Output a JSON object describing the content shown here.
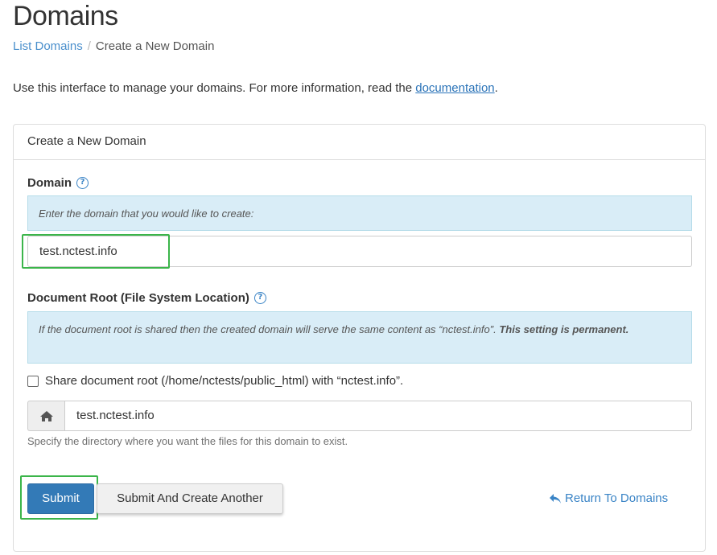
{
  "page": {
    "title": "Domains"
  },
  "breadcrumb": {
    "link": "List Domains",
    "separator": "/",
    "current": "Create a New Domain"
  },
  "intro": {
    "text": "Use this interface to manage your domains. For more information, read the ",
    "link": "documentation",
    "end": "."
  },
  "panel": {
    "heading": "Create a New Domain",
    "domain": {
      "label": "Domain",
      "help_icon": "question-circle-icon",
      "info": "Enter the domain that you would like to create:",
      "value": "test.nctest.info"
    },
    "docroot": {
      "label": "Document Root (File System Location)",
      "help_icon": "question-circle-icon",
      "info_text": "If the document root is shared then the created domain will serve the same content as “nctest.info”. ",
      "info_bold": "This setting is permanent.",
      "share_label": "Share document root (/home/nctests/public_html) with “nctest.info”.",
      "share_checked": false,
      "addon_icon": "home-icon",
      "value": "test.nctest.info",
      "help": "Specify the directory where you want the files for this domain to exist."
    },
    "actions": {
      "submit": "Submit",
      "submit_another": "Submit And Create Another",
      "return_icon": "reply-arrow-icon",
      "return_link": "Return To Domains"
    }
  },
  "colors": {
    "primary": "#337ab7",
    "link": "#3a84c6",
    "info_bg": "#d9edf7",
    "highlight": "#3bb54a"
  }
}
